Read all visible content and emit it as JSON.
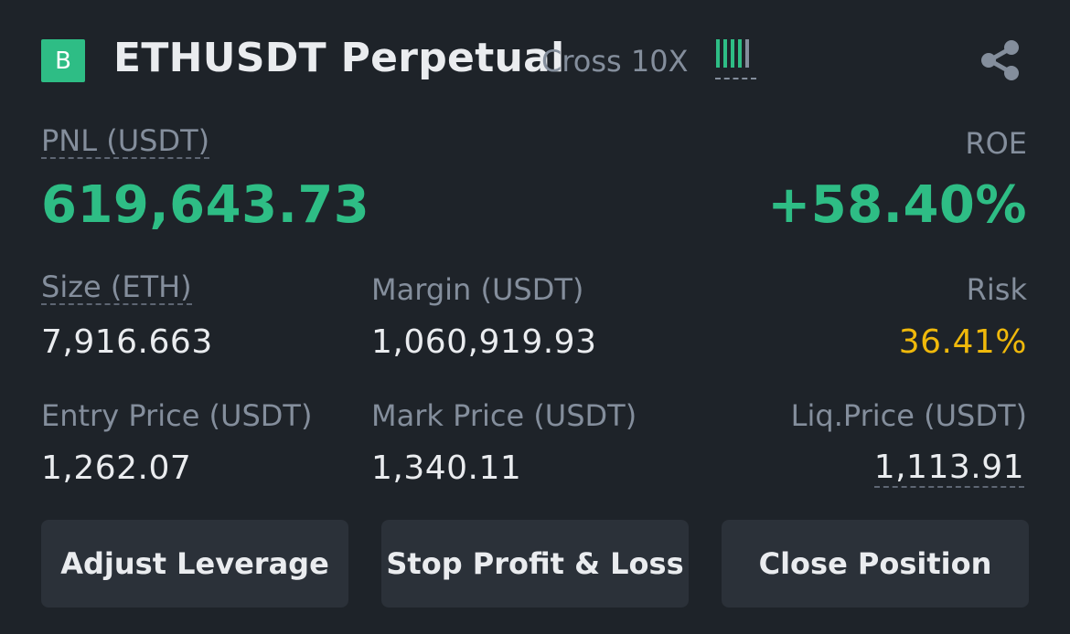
{
  "header": {
    "side_badge": "B",
    "symbol": "ETHUSDT Perpetual",
    "margin_mode": "Cross 10X",
    "risk_level_bars": {
      "active": 4,
      "total": 5
    },
    "share_icon": "share-icon"
  },
  "pnl": {
    "label": "PNL (USDT)",
    "value": "619,643.73"
  },
  "roe": {
    "label": "ROE",
    "value": "+58.40%"
  },
  "size": {
    "label": "Size (ETH)",
    "value": "7,916.663"
  },
  "margin": {
    "label": "Margin (USDT)",
    "value": "1,060,919.93"
  },
  "risk": {
    "label": "Risk",
    "value": "36.41%"
  },
  "entry_price": {
    "label": "Entry Price (USDT)",
    "value": "1,262.07"
  },
  "mark_price": {
    "label": "Mark Price (USDT)",
    "value": "1,340.11"
  },
  "liq_price": {
    "label": "Liq.Price (USDT)",
    "value": "1,113.91"
  },
  "buttons": {
    "adjust_leverage": "Adjust Leverage",
    "stop_profit_loss": "Stop Profit & Loss",
    "close_position": "Close Position"
  },
  "colors": {
    "background": "#1e2329",
    "positive": "#2ebd85",
    "risk": "#f0b90b",
    "muted": "#848e9c",
    "button_bg": "#2b3139"
  }
}
